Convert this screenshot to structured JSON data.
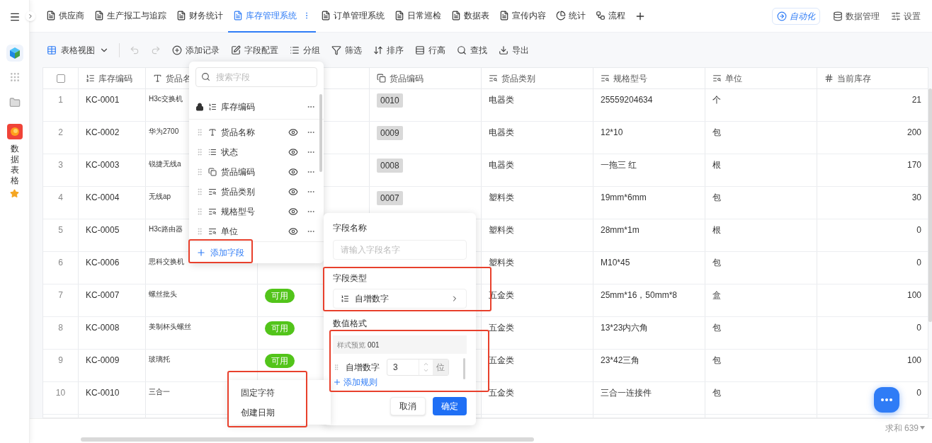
{
  "sidebar": {
    "app_label": "数据表格"
  },
  "tabs": [
    {
      "label": "供应商",
      "kind": "doc",
      "selected": false
    },
    {
      "label": "生产报工与追踪",
      "kind": "doc",
      "selected": false
    },
    {
      "label": "财务统计",
      "kind": "doc",
      "selected": false
    },
    {
      "label": "库存管理系统",
      "kind": "doc",
      "selected": true
    },
    {
      "label": "订单管理系统",
      "kind": "doc",
      "selected": false
    },
    {
      "label": "日常巡检",
      "kind": "doc",
      "selected": false
    },
    {
      "label": "数据表",
      "kind": "doc",
      "selected": false
    },
    {
      "label": "宣传内容",
      "kind": "doc",
      "selected": false
    },
    {
      "label": "统计",
      "kind": "chart",
      "selected": false
    },
    {
      "label": "流程",
      "kind": "flow",
      "selected": false
    }
  ],
  "top_actions": [
    {
      "label": "自动化",
      "kind": "automation"
    },
    {
      "label": "数据管理",
      "kind": "database"
    },
    {
      "label": "设置",
      "kind": "settings"
    }
  ],
  "toolbar": {
    "view": "表格视图",
    "history": [
      {
        "kind": "undo",
        "disabled": true
      },
      {
        "kind": "redo",
        "disabled": true
      }
    ],
    "actions": [
      {
        "label": "添加记录",
        "kind": "add"
      },
      {
        "label": "字段配置",
        "kind": "fields"
      },
      {
        "label": "分组",
        "kind": "group"
      },
      {
        "label": "筛选",
        "kind": "filter"
      },
      {
        "label": "排序",
        "kind": "sort"
      },
      {
        "label": "行高",
        "kind": "height"
      },
      {
        "label": "查找",
        "kind": "find"
      },
      {
        "label": "导出",
        "kind": "export"
      }
    ]
  },
  "table": {
    "columns": [
      {
        "label": "库存编码",
        "kind": "autonumber"
      },
      {
        "label": "货品名",
        "kind": "text"
      },
      {
        "kind": "select"
      },
      {
        "label": "货品编码",
        "kind": "link"
      },
      {
        "label": "货品类别",
        "kind": "lookup"
      },
      {
        "label": "规格型号",
        "kind": "lookup"
      },
      {
        "label": "单位",
        "kind": "lookup"
      },
      {
        "label": "当前库存",
        "kind": "number"
      }
    ],
    "rows": [
      {
        "index": "1",
        "cells": [
          "KC-0001",
          "H3c交换机",
          null,
          "0010",
          "电器类",
          "25559204634",
          "个",
          "21"
        ]
      },
      {
        "index": "2",
        "cells": [
          "KC-0002",
          "华为2700",
          null,
          "0009",
          "电器类",
          "12*10",
          "包",
          "200"
        ]
      },
      {
        "index": "3",
        "cells": [
          "KC-0003",
          "锐捷无线a",
          null,
          "0008",
          "电器类",
          "一拖三 红",
          "根",
          "170"
        ]
      },
      {
        "index": "4",
        "cells": [
          "KC-0004",
          "无线ap",
          null,
          "0007",
          "塑料类",
          "19mm*6mm",
          "包",
          "30"
        ]
      },
      {
        "index": "5",
        "cells": [
          "KC-0005",
          "H3c路由器",
          null,
          null,
          "塑料类",
          "28mm*1m",
          "根",
          "0"
        ]
      },
      {
        "index": "6",
        "cells": [
          "KC-0006",
          "思科交换机",
          null,
          null,
          "塑料类",
          "M10*45",
          "包",
          "0"
        ]
      },
      {
        "index": "7",
        "cells": [
          "KC-0007",
          "螺丝批头",
          "可用",
          null,
          "五金类",
          "25mm*16，50mm*8",
          "盒",
          "100"
        ]
      },
      {
        "index": "8",
        "cells": [
          "KC-0008",
          "美制杯头螺丝",
          "可用",
          null,
          "五金类",
          "13*23内六角",
          "包",
          "0"
        ]
      },
      {
        "index": "9",
        "cells": [
          "KC-0009",
          "玻璃托",
          "可用",
          null,
          "五金类",
          "23*42三角",
          "包",
          "100"
        ]
      },
      {
        "index": "10",
        "cells": [
          "KC-0010",
          "三合一",
          null,
          null,
          "五金类",
          "三合一连接件",
          "包",
          "0"
        ]
      }
    ],
    "summary": "求和 639",
    "select_all": {
      "checked": false
    }
  },
  "field_menu": {
    "search_placeholder": "搜索字段",
    "fields": [
      {
        "label": "库存编码",
        "kind": "autonumber",
        "locked": true
      },
      {
        "label": "货品名称",
        "kind": "text",
        "locked": false
      },
      {
        "label": "状态",
        "kind": "select",
        "locked": false
      },
      {
        "label": "货品编码",
        "kind": "link",
        "locked": false
      },
      {
        "label": "货品类别",
        "kind": "lookup",
        "locked": false
      },
      {
        "label": "规格型号",
        "kind": "lookup",
        "locked": false
      },
      {
        "label": "单位",
        "kind": "lookup",
        "locked": false
      }
    ],
    "add_label": "添加字段"
  },
  "field_editor": {
    "name_label": "字段名称",
    "name_placeholder": "请输入字段名字",
    "type_label": "字段类型",
    "type_value": "自增数字",
    "format_label": "数值格式",
    "preview_label": "样式预览",
    "preview_value": "001",
    "rules": [
      {
        "label": "自增数字",
        "digits": "3",
        "unit": "位"
      }
    ],
    "add_rule": "添加规则",
    "cancel": "取消",
    "confirm": "确定"
  },
  "rule_menu": {
    "items": [
      "固定字符",
      "创建日期"
    ]
  }
}
